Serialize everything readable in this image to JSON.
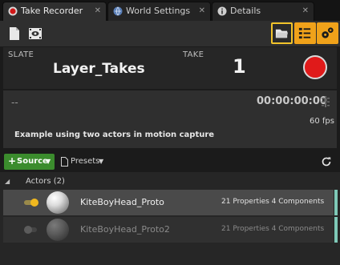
{
  "tabs": [
    {
      "label": "Take Recorder",
      "icon": "record-icon",
      "active": true
    },
    {
      "label": "World Settings",
      "icon": "globe-icon",
      "active": false
    },
    {
      "label": "Details",
      "icon": "info-icon",
      "active": false
    }
  ],
  "toolbar": {
    "new_icon": "document-icon",
    "review_icon": "film-eye-icon",
    "open_icon": "folder-open-icon",
    "list_icon": "list-icon",
    "settings_icon": "settings-gear-icon"
  },
  "slate": {
    "label": "SLATE",
    "name": "Layer_Takes",
    "take_label": "TAKE",
    "take_number": "1"
  },
  "timecode": {
    "dash": "--",
    "time": "00:00:00:00",
    "fps": "60 fps",
    "description": "Example using two actors in motion capture"
  },
  "sources_toolbar": {
    "source_label": "Source",
    "presets_label": "Presets"
  },
  "list": {
    "group_label": "Actors (2)",
    "rows": [
      {
        "name": "KiteBoyHead_Proto",
        "properties": "21 Properties 4 Components",
        "enabled": true
      },
      {
        "name": "KiteBoyHead_Proto2",
        "properties": "21 Properties 4 Components",
        "enabled": false
      }
    ]
  },
  "colors": {
    "accent_orange": "#f0a21a",
    "record_red": "#e01a1a",
    "source_green": "#3b8c2d",
    "row_accent": "#7fc9b8"
  }
}
